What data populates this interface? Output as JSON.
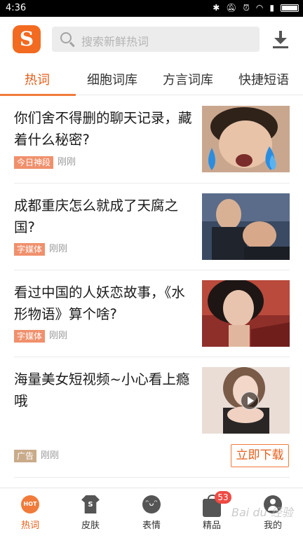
{
  "status_bar": {
    "time": "4:36"
  },
  "header": {
    "logo_letter": "S",
    "search_placeholder": "搜索新鲜热词"
  },
  "tabs": [
    {
      "label": "热词",
      "active": true
    },
    {
      "label": "细胞词库",
      "active": false
    },
    {
      "label": "方言词库",
      "active": false
    },
    {
      "label": "快捷短语",
      "active": false
    }
  ],
  "feed": [
    {
      "title": "你们舍不得删的聊天记录，藏着什么秘密?",
      "tag": "今日神段",
      "time": "刚刚"
    },
    {
      "title": "成都重庆怎么就成了天腐之国?",
      "tag": "字媒体",
      "time": "刚刚"
    },
    {
      "title": "看过中国的人妖恋故事，《水形物语》算个啥?",
      "tag": "字媒体",
      "time": "刚刚"
    },
    {
      "title": "海量美女短视频~小心看上瘾哦",
      "tag": "广告",
      "time": "刚刚",
      "button": "立即下载"
    }
  ],
  "bottom_nav": [
    {
      "label": "热词",
      "icon": "hot-icon",
      "icon_text": "HOT",
      "active": true
    },
    {
      "label": "皮肤",
      "icon": "shirt-icon",
      "icon_text": "S",
      "active": false
    },
    {
      "label": "表情",
      "icon": "face-icon",
      "icon_text": "ᵔᴗᵔ",
      "active": false
    },
    {
      "label": "精品",
      "icon": "bag-icon",
      "active": false,
      "badge": "53"
    },
    {
      "label": "我的",
      "icon": "user-icon",
      "active": false
    }
  ],
  "watermark": "Bai du 经验",
  "colors": {
    "accent": "#f07b3a",
    "tag": "#f0906c",
    "ad_tag": "#c9ab8a",
    "badge": "#ef4a43"
  }
}
